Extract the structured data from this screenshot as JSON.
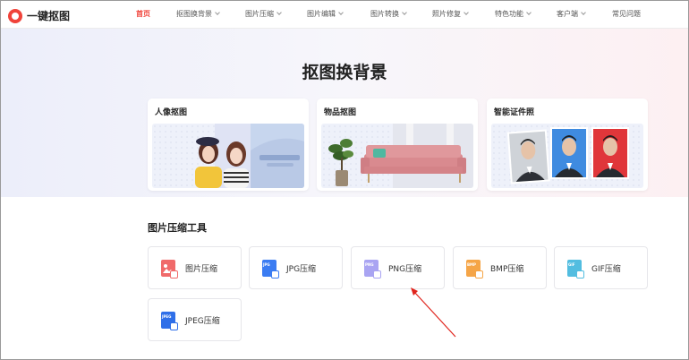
{
  "app": {
    "name": "一键抠图"
  },
  "nav": {
    "items": [
      {
        "label": "首页",
        "active": true,
        "dropdown": false
      },
      {
        "label": "抠图换背景",
        "active": false,
        "dropdown": true
      },
      {
        "label": "图片压缩",
        "active": false,
        "dropdown": true
      },
      {
        "label": "图片编辑",
        "active": false,
        "dropdown": true
      },
      {
        "label": "图片转换",
        "active": false,
        "dropdown": true
      },
      {
        "label": "照片修复",
        "active": false,
        "dropdown": true
      },
      {
        "label": "特色功能",
        "active": false,
        "dropdown": true
      },
      {
        "label": "客户端",
        "active": false,
        "dropdown": true
      },
      {
        "label": "常见问题",
        "active": false,
        "dropdown": false
      }
    ]
  },
  "hero": {
    "title": "抠图换背景",
    "cards": [
      {
        "title": "人像抠图"
      },
      {
        "title": "物品抠图"
      },
      {
        "title": "智能证件照"
      }
    ]
  },
  "tools": {
    "section_title": "图片压缩工具",
    "items": [
      {
        "label": "图片压缩",
        "icon": "image-compress-icon",
        "color": "#f06a6a",
        "tag": ""
      },
      {
        "label": "JPG压缩",
        "icon": "jpg-file-icon",
        "color": "#3b7cf2",
        "tag": "JPG"
      },
      {
        "label": "PNG压缩",
        "icon": "png-file-icon",
        "color": "#a9a4f2",
        "tag": "PNG"
      },
      {
        "label": "BMP压缩",
        "icon": "bmp-file-icon",
        "color": "#f5a547",
        "tag": "BMP"
      },
      {
        "label": "GIF压缩",
        "icon": "gif-file-icon",
        "color": "#52bde0",
        "tag": "GIF"
      },
      {
        "label": "JPEG压缩",
        "icon": "jpeg-file-icon",
        "color": "#2f6fe8",
        "tag": "JPEG"
      }
    ]
  },
  "colors": {
    "accent": "#f0433a",
    "annotation": "#e0241c"
  }
}
